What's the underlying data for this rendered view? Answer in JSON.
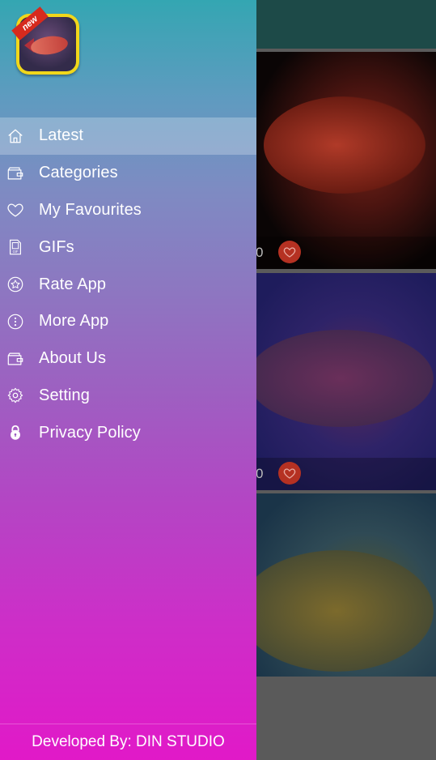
{
  "drawer": {
    "logo": {
      "badge": "new",
      "icon": "arowana-fish-app-icon"
    },
    "menu": [
      {
        "label": "Latest",
        "icon": "home-icon",
        "active": true
      },
      {
        "label": "Categories",
        "icon": "wallet-folder-icon",
        "active": false
      },
      {
        "label": "My Favourites",
        "icon": "heart-icon",
        "active": false
      },
      {
        "label": "GIFs",
        "icon": "gif-file-icon",
        "active": false
      },
      {
        "label": "Rate App",
        "icon": "star-circle-icon",
        "active": false
      },
      {
        "label": "More App",
        "icon": "more-dots-circle-icon",
        "active": false
      },
      {
        "label": "About Us",
        "icon": "wallet-folder-icon",
        "active": false
      },
      {
        "label": "Setting",
        "icon": "gear-icon",
        "active": false
      },
      {
        "label": "Privacy Policy",
        "icon": "lock-icon",
        "active": false
      }
    ],
    "footer": "Developed By: DIN STUDIO"
  },
  "background": {
    "cards": [
      {
        "count": "0",
        "favourite_icon": "heart-icon"
      },
      {
        "count": "0",
        "favourite_icon": "heart-icon"
      },
      {
        "count": "",
        "favourite_icon": ""
      }
    ]
  },
  "colors": {
    "drawer_top": "#34a6b2",
    "drawer_bottom": "#e119c8",
    "toolbar": "#1d4a48",
    "favourite_button": "#b53122",
    "logo_border": "#f1d71a"
  }
}
